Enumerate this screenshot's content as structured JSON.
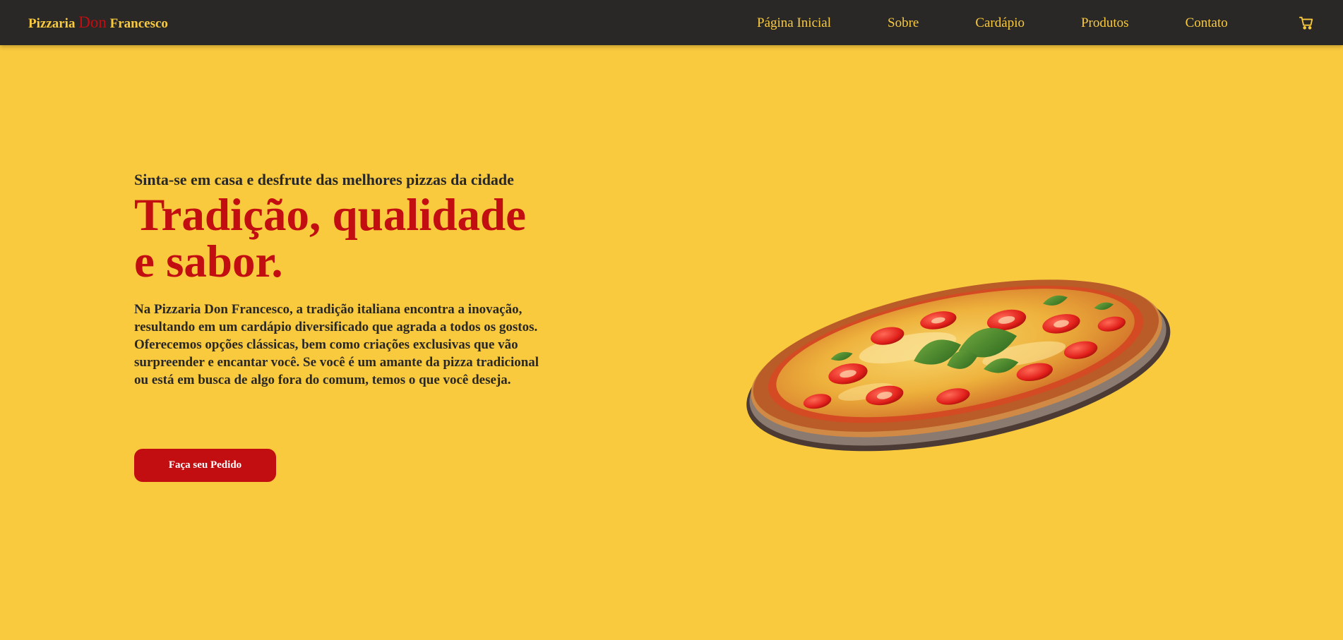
{
  "brand": {
    "part1": "Pizzaria",
    "part2": "Don",
    "part3": "Francesco"
  },
  "nav": {
    "items": [
      "Página Inicial",
      "Sobre",
      "Cardápio",
      "Produtos",
      "Contato"
    ]
  },
  "icons": {
    "cart": "shopping-cart-icon"
  },
  "hero": {
    "tagline": "Sinta-se em casa e desfrute das melhores pizzas da cidade",
    "headline": "Tradição, qualidade e sabor.",
    "description": "Na Pizzaria Don Francesco, a tradição italiana encontra a inovação, resultando em um cardápio diversificado que agrada a todos os gostos. Oferecemos opções clássicas, bem como criações exclusivas que vão surpreender e encantar você. Se você é um amante da pizza tradicional ou está em busca de algo fora do comum, temos o que você deseja.",
    "cta_label": "Faça seu Pedido"
  },
  "colors": {
    "background": "#f9c93e",
    "navbar": "#292826",
    "accent_red": "#c20d11",
    "text_dark": "#292826"
  }
}
